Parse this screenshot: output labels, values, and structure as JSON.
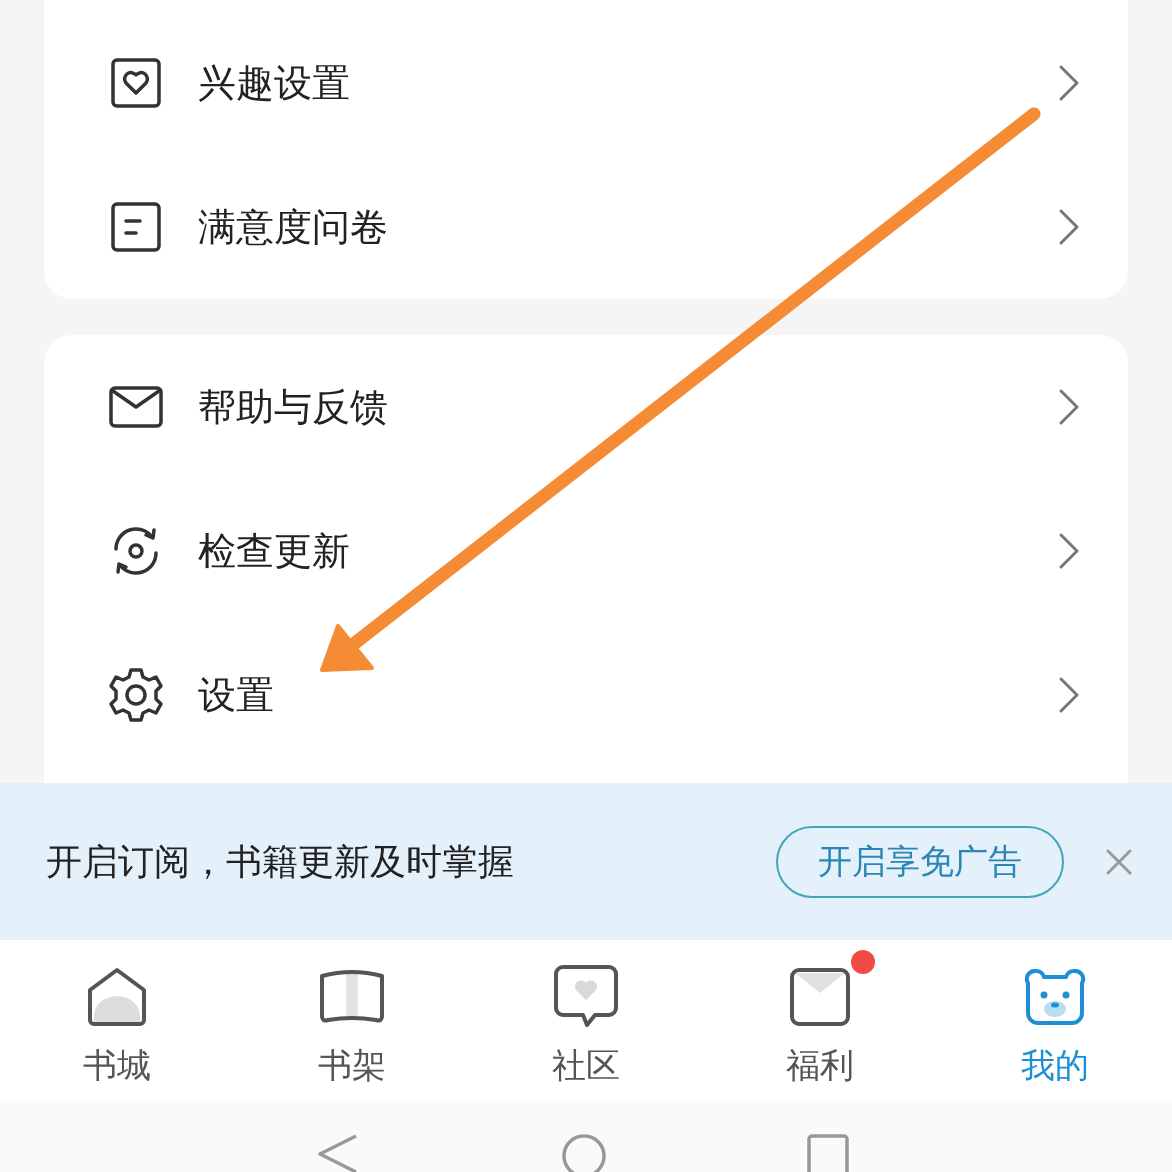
{
  "menu_groups": [
    {
      "items": [
        {
          "label": "兴趣设置"
        },
        {
          "label": "满意度问卷"
        }
      ]
    },
    {
      "items": [
        {
          "label": "帮助与反馈"
        },
        {
          "label": "检查更新"
        },
        {
          "label": "设置"
        }
      ]
    }
  ],
  "subscribe_banner": {
    "message": "开启订阅，书籍更新及时掌握",
    "button": "开启享免广告"
  },
  "bottom_nav": [
    {
      "label": "书城",
      "selected": false,
      "badge": false
    },
    {
      "label": "书架",
      "selected": false,
      "badge": false
    },
    {
      "label": "社区",
      "selected": false,
      "badge": false
    },
    {
      "label": "福利",
      "selected": false,
      "badge": true
    },
    {
      "label": "我的",
      "selected": true,
      "badge": false
    }
  ]
}
